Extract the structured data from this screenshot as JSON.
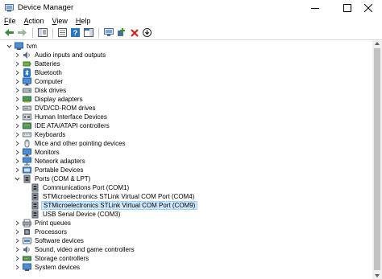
{
  "window": {
    "title": "Device Manager"
  },
  "menu": [
    {
      "label": "File",
      "key": "F",
      "rest": "ile"
    },
    {
      "label": "Action",
      "key": "A",
      "rest": "ction"
    },
    {
      "label": "View",
      "key": "V",
      "rest": "iew"
    },
    {
      "label": "Help",
      "key": "H",
      "rest": "elp"
    }
  ],
  "toolbar": {
    "buttons": [
      "back",
      "forward",
      "show-hide-console-tree",
      "properties",
      "help",
      "action-pane",
      "scan-hardware",
      "add-driver",
      "uninstall",
      "update-driver"
    ]
  },
  "tree": {
    "root": "tvm",
    "categories": [
      {
        "label": "Audio inputs and outputs",
        "icon": "speaker-icon",
        "expanded": false
      },
      {
        "label": "Batteries",
        "icon": "battery-icon",
        "expanded": false
      },
      {
        "label": "Bluetooth",
        "icon": "bluetooth-icon",
        "expanded": false
      },
      {
        "label": "Computer",
        "icon": "monitor-icon",
        "expanded": false
      },
      {
        "label": "Disk drives",
        "icon": "disk-icon",
        "expanded": false
      },
      {
        "label": "Display adapters",
        "icon": "display-adapter-icon",
        "expanded": false
      },
      {
        "label": "DVD/CD-ROM drives",
        "icon": "dvd-icon",
        "expanded": false
      },
      {
        "label": "Human Interface Devices",
        "icon": "hid-icon",
        "expanded": false
      },
      {
        "label": "IDE ATA/ATAPI controllers",
        "icon": "ide-icon",
        "expanded": false
      },
      {
        "label": "Keyboards",
        "icon": "keyboard-icon",
        "expanded": false
      },
      {
        "label": "Mice and other pointing devices",
        "icon": "mouse-icon",
        "expanded": false
      },
      {
        "label": "Monitors",
        "icon": "monitor-icon",
        "expanded": false
      },
      {
        "label": "Network adapters",
        "icon": "network-icon",
        "expanded": false
      },
      {
        "label": "Portable Devices",
        "icon": "portable-device-icon",
        "expanded": false
      },
      {
        "label": "Ports (COM & LPT)",
        "icon": "port-icon",
        "expanded": true,
        "children": [
          {
            "label": "Communications Port (COM1)",
            "icon": "port-icon",
            "selected": false
          },
          {
            "label": "STMicroelectronics STLink Virtual COM Port (COM4)",
            "icon": "port-icon",
            "selected": false
          },
          {
            "label": "STMicroelectronics STLink Virtual COM Port (COM9)",
            "icon": "port-icon",
            "selected": true
          },
          {
            "label": "USB Serial Device (COM3)",
            "icon": "port-icon",
            "selected": false
          }
        ]
      },
      {
        "label": "Print queues",
        "icon": "printer-icon",
        "expanded": false
      },
      {
        "label": "Processors",
        "icon": "processor-icon",
        "expanded": false
      },
      {
        "label": "Software devices",
        "icon": "software-device-icon",
        "expanded": false
      },
      {
        "label": "Sound, video and game controllers",
        "icon": "speaker-icon",
        "expanded": false
      },
      {
        "label": "Storage controllers",
        "icon": "storage-icon",
        "expanded": false
      },
      {
        "label": "System devices",
        "icon": "system-icon",
        "expanded": false
      }
    ]
  },
  "colors": {
    "selection_bg": "#cce8ff",
    "selection_border": "#99d1ff",
    "accent_blue": "#2a73c5"
  }
}
